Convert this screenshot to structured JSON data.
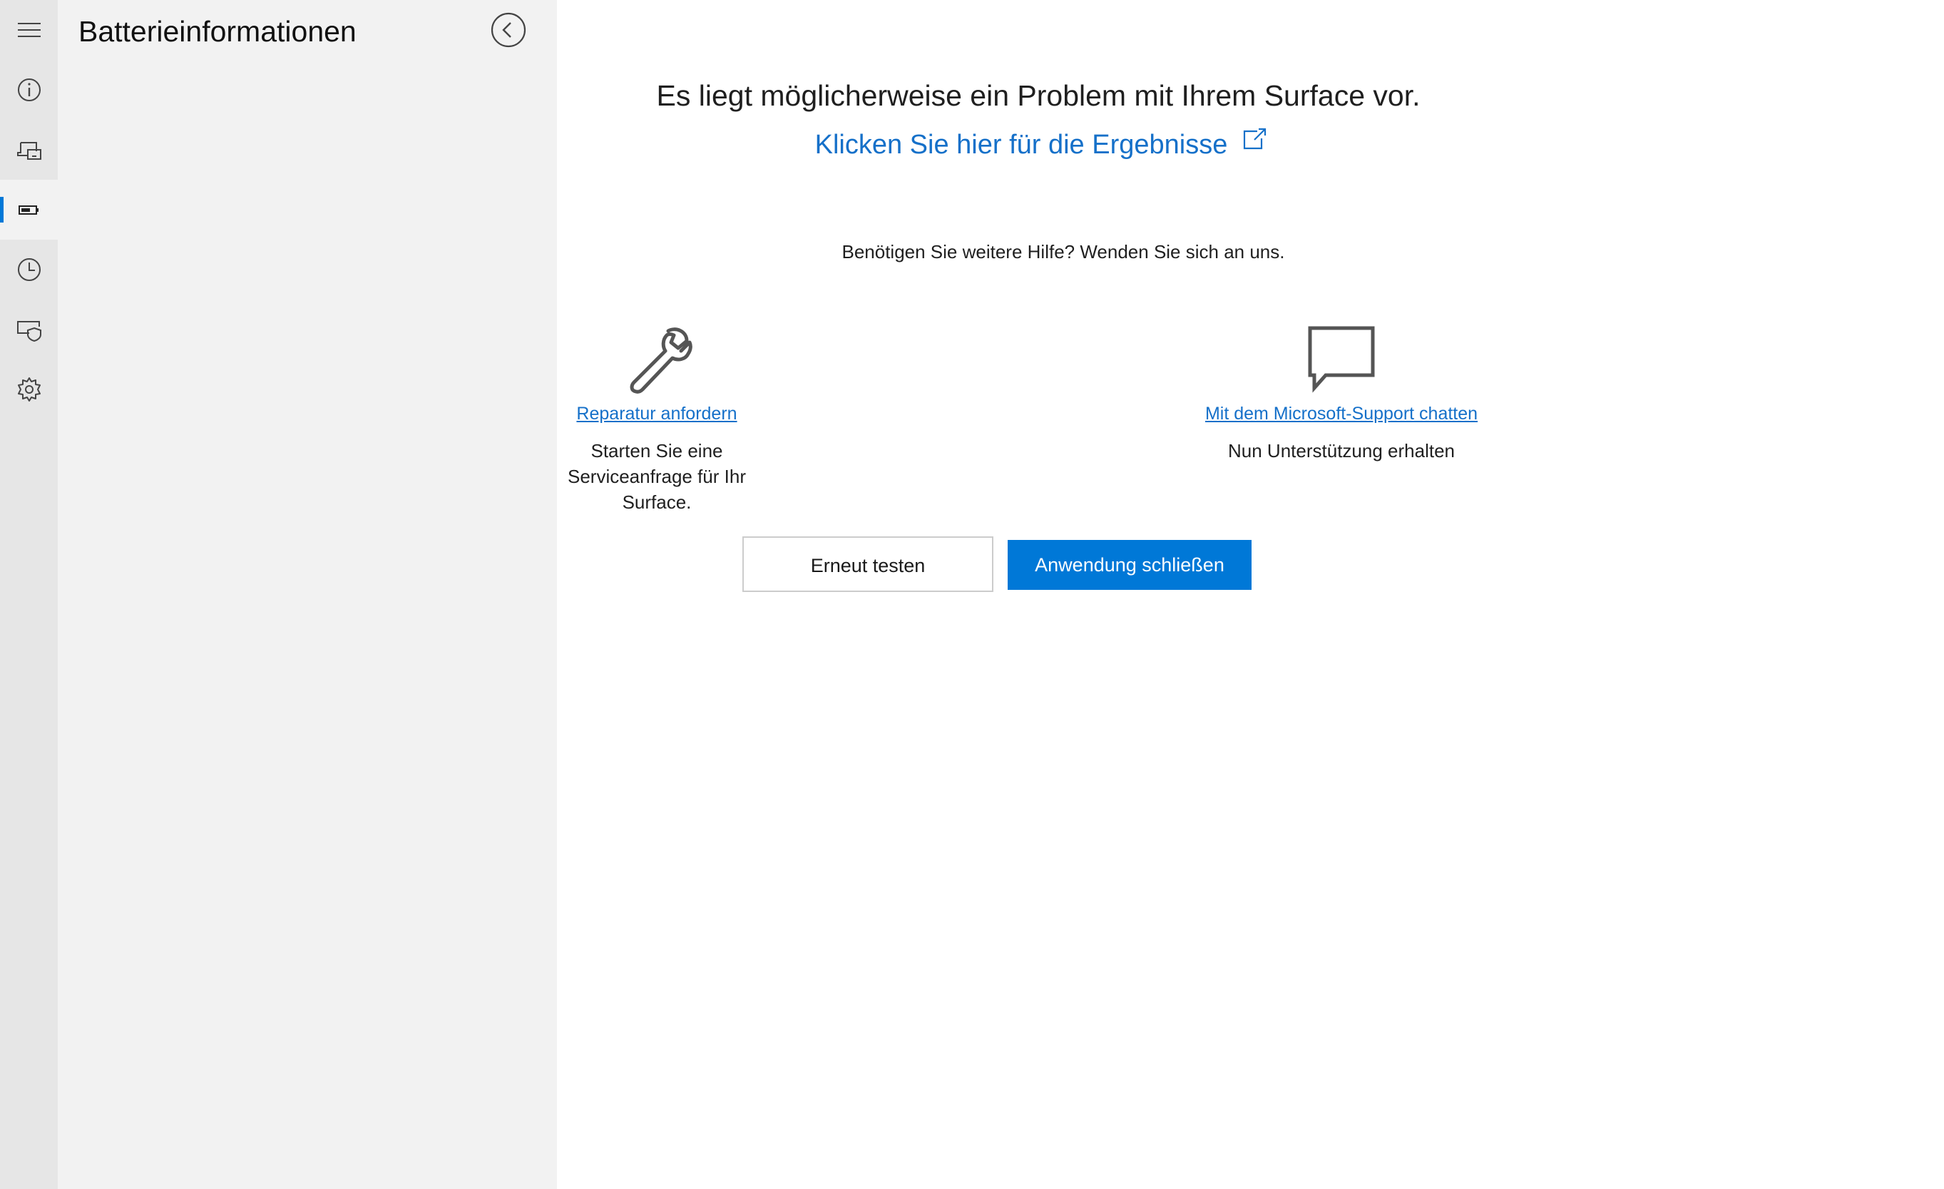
{
  "sidebar": {
    "title": "Batterieinformationen",
    "rail": [
      {
        "icon": "hamburger-menu-icon"
      },
      {
        "icon": "info-icon"
      },
      {
        "icon": "devices-icon"
      },
      {
        "icon": "battery-icon",
        "selected": true
      },
      {
        "icon": "history-clock-icon"
      },
      {
        "icon": "device-shield-icon"
      },
      {
        "icon": "gear-icon"
      }
    ],
    "back_icon": "back-arrow-circle-icon"
  },
  "main": {
    "headline": "Es liegt möglicherweise ein Problem mit Ihrem Surface vor.",
    "results_link": "Klicken Sie hier für die Ergebnisse",
    "help_text": "Benötigen Sie weitere Hilfe? Wenden Sie sich an uns.",
    "options": [
      {
        "icon": "wrench-icon",
        "link": "Reparatur anfordern",
        "desc_line1": "Starten Sie eine",
        "desc_line2": "Serviceanfrage für Ihr Surface."
      },
      {
        "icon": "chat-bubble-icon",
        "link": "Mit dem Microsoft-Support chatten",
        "desc_line1": "Nun Unterstützung erhalten"
      }
    ],
    "buttons": {
      "retry": "Erneut testen",
      "close": "Anwendung schließen"
    }
  },
  "colors": {
    "accent": "#0078d7",
    "link": "#1570c9",
    "rail_bg": "#e6e6e6",
    "panel_bg": "#f2f2f2"
  }
}
